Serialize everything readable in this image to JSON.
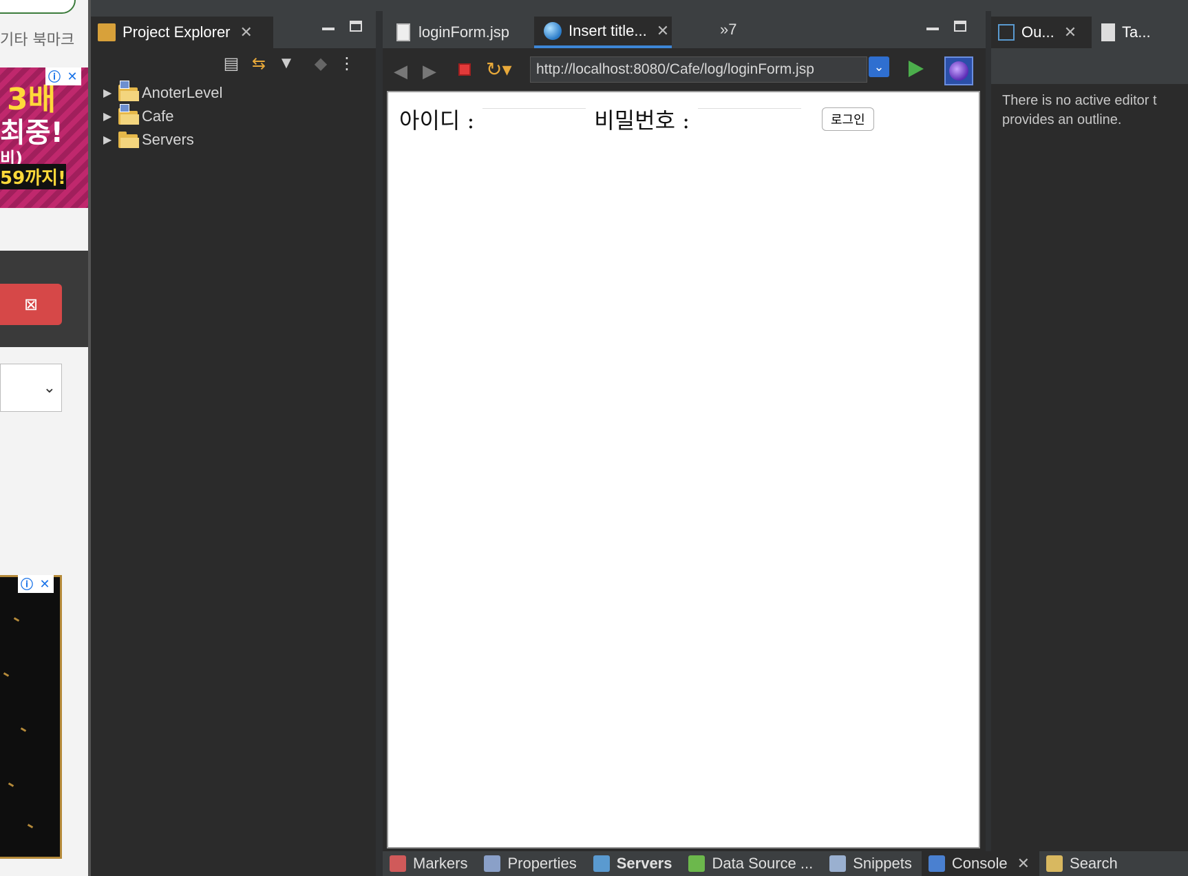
{
  "browser_strip": {
    "bookmark_text": "기타 북마크",
    "ad_lines": [
      "3배",
      "최중!",
      "비)",
      "59까지!"
    ],
    "ad_info": "ⓘ",
    "ad_close": "✕",
    "red_button_icon": "⊠",
    "select_chevron": "⌄"
  },
  "project_explorer": {
    "title": "Project Explorer",
    "items": [
      {
        "label": "AnoterLevel",
        "type": "project"
      },
      {
        "label": "Cafe",
        "type": "project"
      },
      {
        "label": "Servers",
        "type": "folder"
      }
    ]
  },
  "editor": {
    "tabs": [
      {
        "label": "loginForm.jsp",
        "active": false
      },
      {
        "label": "Insert title...",
        "active": true
      }
    ],
    "overflow": "»7",
    "url": "http://localhost:8080/Cafe/log/loginForm.jsp",
    "form": {
      "id_label": "아이디 :",
      "pw_label": "비밀번호 :",
      "login_button": "로그인"
    }
  },
  "outline": {
    "tabs": [
      {
        "label": "Ou..."
      },
      {
        "label": "Ta..."
      }
    ],
    "message_line1": "There is no active editor t",
    "message_line2": "provides an outline."
  },
  "bottom_tabs": [
    {
      "label": "Markers",
      "color": "#d05a5a"
    },
    {
      "label": "Properties",
      "color": "#8aa0c8"
    },
    {
      "label": "Servers",
      "color": "#5a9ad0",
      "bold": true
    },
    {
      "label": "Data Source ...",
      "color": "#6cb84c"
    },
    {
      "label": "Snippets",
      "color": "#9ab0d0"
    },
    {
      "label": "Console",
      "color": "#4a80d0",
      "active": true
    },
    {
      "label": "Search",
      "color": "#d8b860"
    }
  ],
  "colors": {
    "accent": "#3d86d6",
    "panel_bg": "#2b2b2b",
    "tabbar_bg": "#3c3f41"
  }
}
